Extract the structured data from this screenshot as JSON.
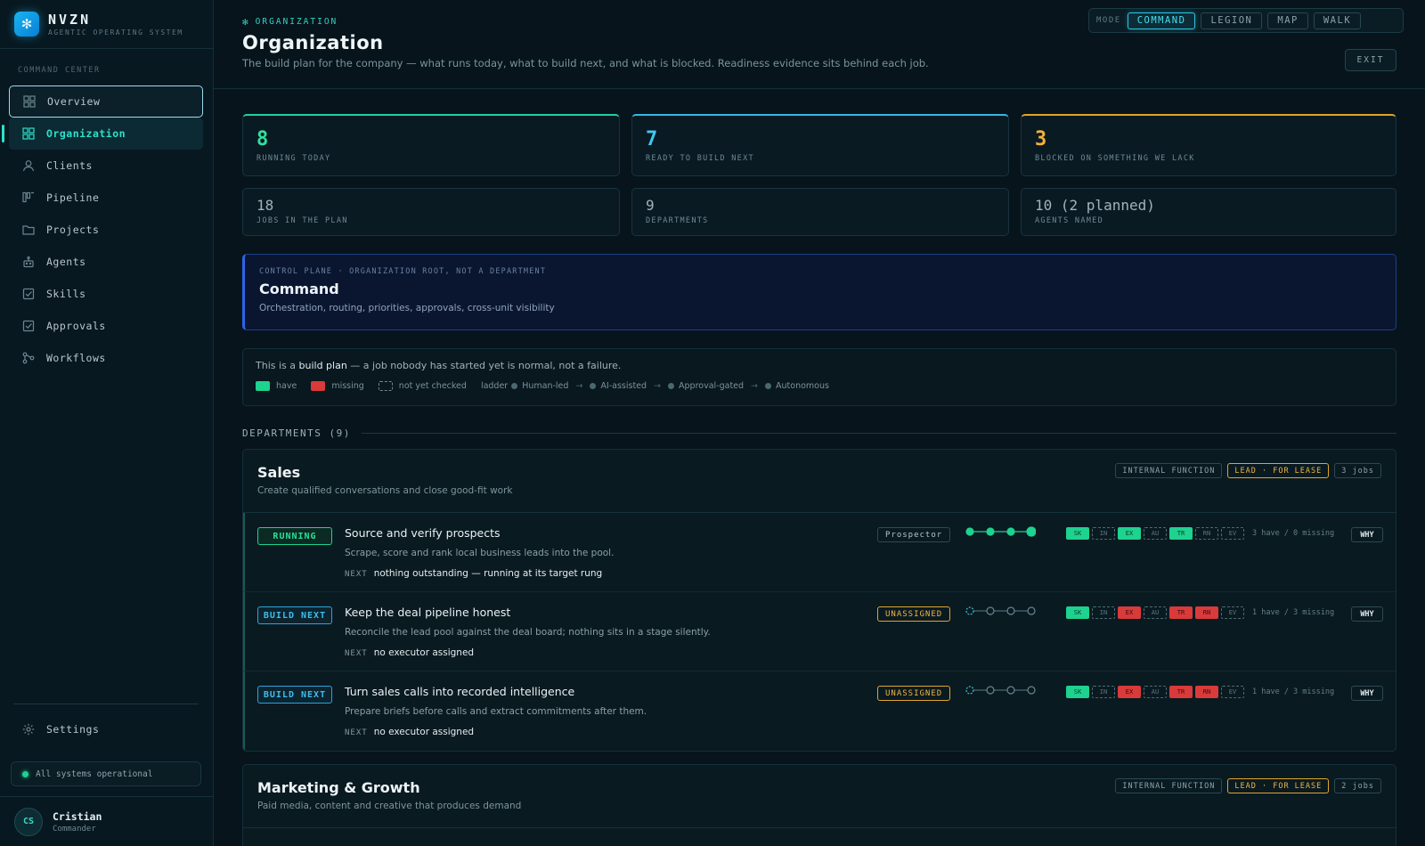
{
  "brand": {
    "name": "NVZN",
    "tagline": "AGENTIC OPERATING SYSTEM",
    "logo_icon": "spark-icon"
  },
  "sidebar": {
    "section_label": "COMMAND CENTER",
    "items": [
      {
        "label": "Overview",
        "icon": "grid-icon",
        "state": "hover"
      },
      {
        "label": "Organization",
        "icon": "grid-icon",
        "state": "active"
      },
      {
        "label": "Clients",
        "icon": "user-icon"
      },
      {
        "label": "Pipeline",
        "icon": "kanban-icon"
      },
      {
        "label": "Projects",
        "icon": "folder-icon"
      },
      {
        "label": "Agents",
        "icon": "robot-icon"
      },
      {
        "label": "Skills",
        "icon": "checkbox-icon"
      },
      {
        "label": "Approvals",
        "icon": "checkbox-icon"
      },
      {
        "label": "Workflows",
        "icon": "workflow-icon"
      }
    ],
    "settings_label": "Settings",
    "status": "All systems operational",
    "user": {
      "initials": "CS",
      "name": "Cristian",
      "role": "Commander"
    }
  },
  "header": {
    "eyebrow": "ORGANIZATION",
    "title": "Organization",
    "subtitle": "The build plan for the company — what runs today, what to build next, and what is blocked. Readiness evidence sits behind each job.",
    "mode_label": "MODE",
    "modes": [
      "COMMAND",
      "LEGION",
      "MAP",
      "WALK"
    ],
    "active_mode": "COMMAND",
    "exit_label": "EXIT"
  },
  "stats": {
    "running": {
      "value": "8",
      "label": "RUNNING TODAY",
      "color": "#2fe0a0"
    },
    "ready": {
      "value": "7",
      "label": "READY TO BUILD NEXT",
      "color": "#3ec8f0"
    },
    "blocked": {
      "value": "3",
      "label": "BLOCKED ON SOMETHING WE LACK",
      "color": "#f2b23a"
    },
    "jobs": {
      "value": "18",
      "label": "JOBS IN THE PLAN"
    },
    "departments": {
      "value": "9",
      "label": "DEPARTMENTS"
    },
    "agents": {
      "value": "10 (2 planned)",
      "label": "AGENTS NAMED"
    }
  },
  "command": {
    "eyebrow": "CONTROL PLANE · ORGANIZATION ROOT, NOT A DEPARTMENT",
    "title": "Command",
    "description": "Orchestration, routing, priorities, approvals, cross-unit visibility"
  },
  "note": {
    "prefix": "This is a ",
    "emphasis": "build plan",
    "suffix": " — a job nobody has started yet is normal, not a failure.",
    "legend": {
      "have": "have",
      "missing": "missing",
      "nyc": "not yet checked"
    },
    "ladder_label": "ladder",
    "ladder": [
      "Human-led",
      "AI-assisted",
      "Approval-gated",
      "Autonomous"
    ]
  },
  "departments_heading": "DEPARTMENTS (9)",
  "departments": [
    {
      "name": "Sales",
      "description": "Create qualified conversations and close good-fit work",
      "tags": [
        "INTERNAL FUNCTION",
        "LEAD · FOR LEASE",
        "3 jobs"
      ],
      "jobs": [
        {
          "state": "RUNNING",
          "title": "Source and verify prospects",
          "description": "Scrape, score and rank local business leads into the pool.",
          "next_label": "NEXT",
          "next": "nothing outstanding — running at its target rung",
          "owner": "Prospector",
          "rung": 4,
          "pips": [
            [
              "SK",
              "have"
            ],
            [
              "IN",
              "nyc"
            ],
            [
              "EX",
              "have"
            ],
            [
              "AU",
              "nyc"
            ],
            [
              "TR",
              "have"
            ],
            [
              "RN",
              "nyc"
            ],
            [
              "EV",
              "nyc"
            ]
          ],
          "summary": "3 have / 0 missing",
          "why": "WHY"
        },
        {
          "state": "BUILD NEXT",
          "title": "Keep the deal pipeline honest",
          "description": "Reconcile the lead pool against the deal board; nothing sits in a stage silently.",
          "next_label": "NEXT",
          "next": "no executor assigned",
          "owner": "UNASSIGNED",
          "rung": 0,
          "pips": [
            [
              "SK",
              "have"
            ],
            [
              "IN",
              "nyc"
            ],
            [
              "EX",
              "miss"
            ],
            [
              "AU",
              "nyc"
            ],
            [
              "TR",
              "miss"
            ],
            [
              "RN",
              "miss"
            ],
            [
              "EV",
              "nyc"
            ]
          ],
          "summary": "1 have / 3 missing",
          "why": "WHY"
        },
        {
          "state": "BUILD NEXT",
          "title": "Turn sales calls into recorded intelligence",
          "description": "Prepare briefs before calls and extract commitments after them.",
          "next_label": "NEXT",
          "next": "no executor assigned",
          "owner": "UNASSIGNED",
          "rung": 0,
          "pips": [
            [
              "SK",
              "have"
            ],
            [
              "IN",
              "nyc"
            ],
            [
              "EX",
              "miss"
            ],
            [
              "AU",
              "nyc"
            ],
            [
              "TR",
              "miss"
            ],
            [
              "RN",
              "miss"
            ],
            [
              "EV",
              "nyc"
            ]
          ],
          "summary": "1 have / 3 missing",
          "why": "WHY"
        }
      ]
    },
    {
      "name": "Marketing & Growth",
      "description": "Paid media, content and creative that produces demand",
      "tags": [
        "INTERNAL FUNCTION",
        "LEAD · FOR LEASE",
        "2 jobs"
      ]
    }
  ]
}
